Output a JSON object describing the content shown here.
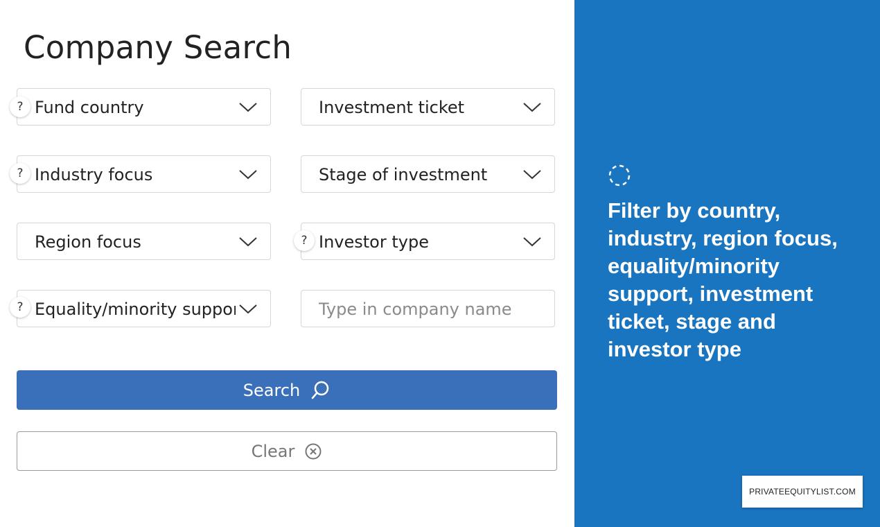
{
  "page": {
    "title": "Company Search"
  },
  "filters": {
    "fund_country": "Fund country",
    "investment_ticket": "Investment ticket",
    "industry_focus": "Industry focus",
    "stage_of_investment": "Stage of investment",
    "region_focus": "Region focus",
    "investor_type": "Investor type",
    "equality_minority_support": "Equality/minority support",
    "company_name_placeholder": "Type in company name"
  },
  "help_marker": "?",
  "buttons": {
    "search": "Search",
    "clear": "Clear"
  },
  "promo": {
    "text": "Filter by country, industry, region focus, equality/minority support, investment ticket, stage and investor type"
  },
  "brand": {
    "site": "PRIVATEEQUITYLIST.COM"
  },
  "colors": {
    "accent_panel": "#1a75c1",
    "search_button": "#3a70ba"
  },
  "icons": [
    "chevron-down-icon",
    "help-icon",
    "search-icon",
    "clear-circle-x-icon",
    "loading-spinner-icon"
  ]
}
